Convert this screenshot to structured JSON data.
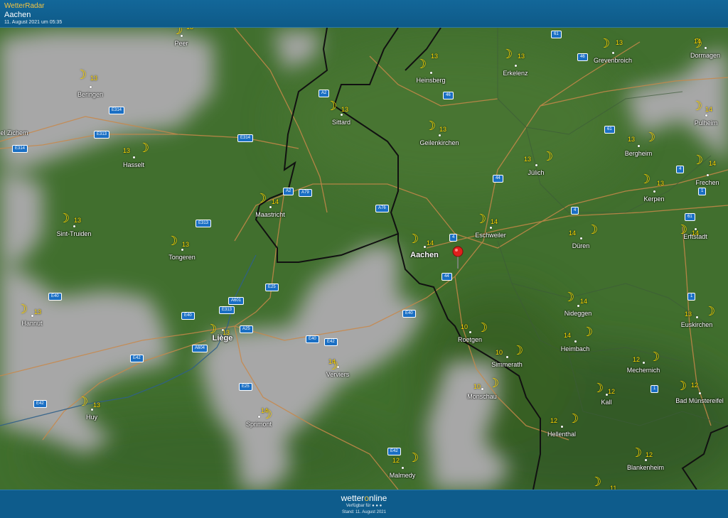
{
  "header": {
    "app_name": "WetterRadar",
    "location": "Aachen",
    "datetime": "11. August 2021 um 05:35"
  },
  "footer": {
    "logo_text_left": "wetter",
    "logo_text_o": "o",
    "logo_text_right": "nline",
    "available_label": "Verfügbar für",
    "available_icons": "● ● ●",
    "stand": "Stand: 11. August 2021"
  },
  "colors": {
    "header_bg": "#0e5c8c",
    "app_name": "#f4c542",
    "forest_green": "#3e6b2c",
    "cloud_gray": "#a9a9a9",
    "temperature": "#ffd700",
    "road_badge": "#1a6fc4",
    "pin": "#e0201c"
  },
  "map": {
    "marker_icon": "location-pin-icon",
    "weather_icon": "crescent-moon-icon",
    "cities": [
      {
        "name": "Peer",
        "temp": "13"
      },
      {
        "name": "Beringen",
        "temp": "13"
      },
      {
        "name": "Heinsberg",
        "temp": "13"
      },
      {
        "name": "Erkelenz",
        "temp": "13"
      },
      {
        "name": "Grevenbroich",
        "temp": "13"
      },
      {
        "name": "Dormagen",
        "temp": "14"
      },
      {
        "name": "Sittard",
        "temp": "13"
      },
      {
        "name": "Geilenkirchen",
        "temp": "13"
      },
      {
        "name": "Pulheim",
        "temp": "14"
      },
      {
        "name": "Hasselt",
        "temp": "13"
      },
      {
        "name": "Bergheim",
        "temp": "13"
      },
      {
        "name": "Jülich",
        "temp": "13"
      },
      {
        "name": "Frechen",
        "temp": "14"
      },
      {
        "name": "Maastricht",
        "temp": "14"
      },
      {
        "name": "Kerpen",
        "temp": "13"
      },
      {
        "name": "Sint-Truiden",
        "temp": "13"
      },
      {
        "name": "Eschweiler",
        "temp": "14"
      },
      {
        "name": "Aachen",
        "temp": "14"
      },
      {
        "name": "Düren",
        "temp": "14"
      },
      {
        "name": "Erftstadt",
        "temp": "14"
      },
      {
        "name": "Tongeren",
        "temp": "13"
      },
      {
        "name": "Hannut",
        "temp": "13"
      },
      {
        "name": "Nideggen",
        "temp": "14"
      },
      {
        "name": "Euskirchen",
        "temp": "13"
      },
      {
        "name": "Liège",
        "temp": "13"
      },
      {
        "name": "Roetgen",
        "temp": "10"
      },
      {
        "name": "Heimbach",
        "temp": "14"
      },
      {
        "name": "Simmerath",
        "temp": "10"
      },
      {
        "name": "Verviers",
        "temp": "14"
      },
      {
        "name": "Mechernich",
        "temp": "12"
      },
      {
        "name": "Monschau",
        "temp": "10"
      },
      {
        "name": "Bad Münstereifel",
        "temp": "12"
      },
      {
        "name": "Kall",
        "temp": "12"
      },
      {
        "name": "Huy",
        "temp": "13"
      },
      {
        "name": "Sprimont",
        "temp": "14"
      },
      {
        "name": "Hellenthal",
        "temp": "12"
      },
      {
        "name": "Blankenheim",
        "temp": "12"
      },
      {
        "name": "Malmedy",
        "temp": "12"
      }
    ],
    "partial_label": "el Zichem",
    "extra_temp": "11",
    "roads": [
      "61",
      "46",
      "A2",
      "46",
      "E314",
      "E313",
      "E314",
      "61",
      "E314",
      "44",
      "4",
      "A2",
      "A79",
      "A76",
      "1",
      "61",
      "4",
      "4",
      "E313",
      "44",
      "A601",
      "E40",
      "E25",
      "E313",
      "E40",
      "A25",
      "1",
      "E40",
      "E40",
      "E42",
      "A604",
      "E42",
      "E25",
      "E42",
      "1",
      "E42"
    ]
  }
}
